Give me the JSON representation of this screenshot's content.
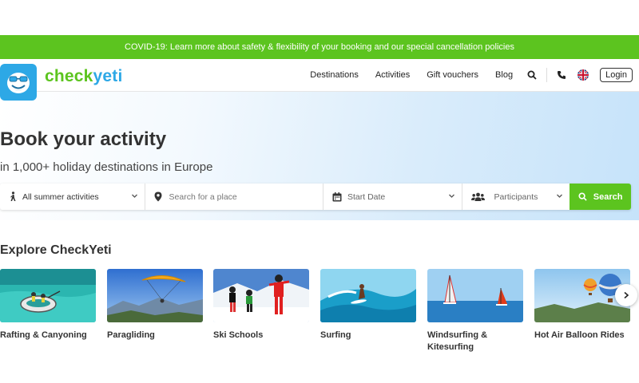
{
  "banner": {
    "text": "COVID-19: Learn more about safety & flexibility of your booking and our special cancellation policies"
  },
  "header": {
    "logo": {
      "part1": "check",
      "part2": "yeti"
    },
    "nav": [
      "Destinations",
      "Activities",
      "Gift vouchers",
      "Blog"
    ],
    "login": "Login",
    "icons": [
      "search-icon",
      "phone-icon",
      "uk-flag-icon"
    ]
  },
  "hero": {
    "title": "Book your activity",
    "subtitle": "in 1,000+ holiday destinations in Europe"
  },
  "search": {
    "activity": "All summer activities",
    "place_placeholder": "Search for a place",
    "date": "Start Date",
    "participants": "Participants",
    "button": "Search"
  },
  "explore": {
    "title": "Explore CheckYeti",
    "cards": [
      {
        "label": "Rafting & Canyoning"
      },
      {
        "label": "Paragliding"
      },
      {
        "label": "Ski Schools"
      },
      {
        "label": "Surfing"
      },
      {
        "label": "Windsurfing & Kitesurfing"
      },
      {
        "label": "Hot Air Balloon Rides"
      }
    ]
  },
  "colors": {
    "brand_green": "#5cc41f",
    "brand_blue": "#2da8e6"
  }
}
